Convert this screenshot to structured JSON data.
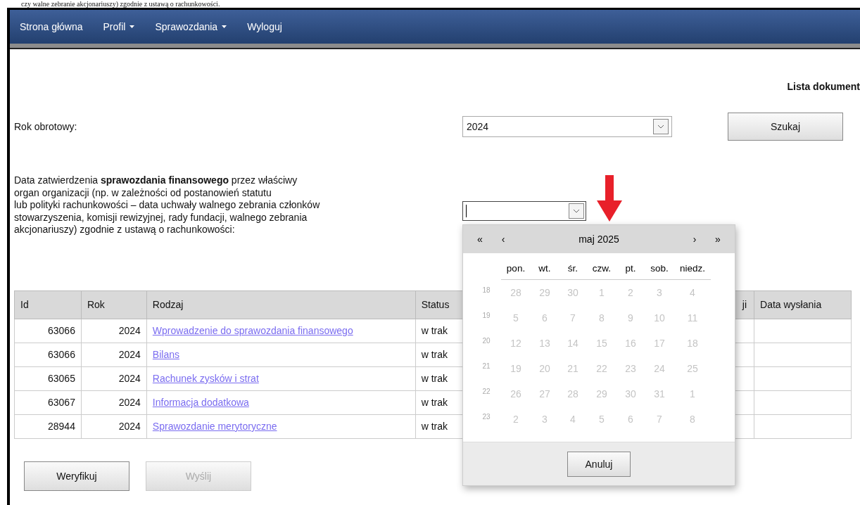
{
  "caption_fragment": "czy walne zebranie akcjonariuszy) zgodnie z ustawą o rachunkowości.",
  "nav": [
    {
      "label": "Strona główna",
      "dropdown": false
    },
    {
      "label": "Profil",
      "dropdown": true
    },
    {
      "label": "Sprawozdania",
      "dropdown": true
    },
    {
      "label": "Wyloguj",
      "dropdown": false
    }
  ],
  "page_title": "Lista dokument",
  "fiscal_year": {
    "label": "Rok obrotowy:",
    "value": "2024"
  },
  "search_button": "Szukaj",
  "approval_date": {
    "label_lines": [
      "Data zatwierdzenia **sprawozdania finansowego** przez właściwy",
      "organ organizacji (np. w zależności od postanowień statutu",
      "lub polityki rachunkowości – data uchwały walnego zebrania członków",
      "stowarzyszenia, komisji rewizyjnej, rady fundacji, walnego zebrania",
      "akcjonariuszy) zgodnie z ustawą o rachunkowości:"
    ],
    "focused": true
  },
  "calendar": {
    "prev_year": "«",
    "prev_month": "‹",
    "month": "maj 2025",
    "next_month": "›",
    "next_year": "»",
    "weekdays": [
      "pon.",
      "wt.",
      "śr.",
      "czw.",
      "pt.",
      "sob.",
      "niedz."
    ],
    "days_disabled": true,
    "weeks": [
      {
        "number": "18",
        "days": [
          "28",
          "29",
          "30",
          "1",
          "2",
          "3",
          "4"
        ]
      },
      {
        "number": "19",
        "days": [
          "5",
          "6",
          "7",
          "8",
          "9",
          "10",
          "11"
        ]
      },
      {
        "number": "20",
        "days": [
          "12",
          "13",
          "14",
          "15",
          "16",
          "17",
          "18"
        ]
      },
      {
        "number": "21",
        "days": [
          "19",
          "20",
          "21",
          "22",
          "23",
          "24",
          "25"
        ]
      },
      {
        "number": "22",
        "days": [
          "26",
          "27",
          "28",
          "29",
          "30",
          "31",
          "1"
        ]
      },
      {
        "number": "23",
        "days": [
          "2",
          "3",
          "4",
          "5",
          "6",
          "7",
          "8"
        ]
      }
    ],
    "cancel_button": "Anuluj"
  },
  "table": {
    "columns": [
      "Id",
      "Rok",
      "Rodzaj",
      "Status",
      "ji",
      "Data wysłania"
    ],
    "rows": [
      {
        "id": "63066",
        "year": "2024",
        "type": "Wprowadzenie do sprawozdania finansowego",
        "status": "w trak"
      },
      {
        "id": "63066",
        "year": "2024",
        "type": "Bilans",
        "status": "w trak"
      },
      {
        "id": "63065",
        "year": "2024",
        "type": "Rachunek zysków i strat",
        "status": "w trak"
      },
      {
        "id": "63067",
        "year": "2024",
        "type": "Informacja dodatkowa",
        "status": "w trak"
      },
      {
        "id": "28944",
        "year": "2024",
        "type": "Sprawozdanie merytoryczne",
        "status": "w trak"
      }
    ]
  },
  "actions": [
    {
      "label": "Weryfikuj",
      "disabled": false
    },
    {
      "label": "Wyślij",
      "disabled": true
    }
  ]
}
